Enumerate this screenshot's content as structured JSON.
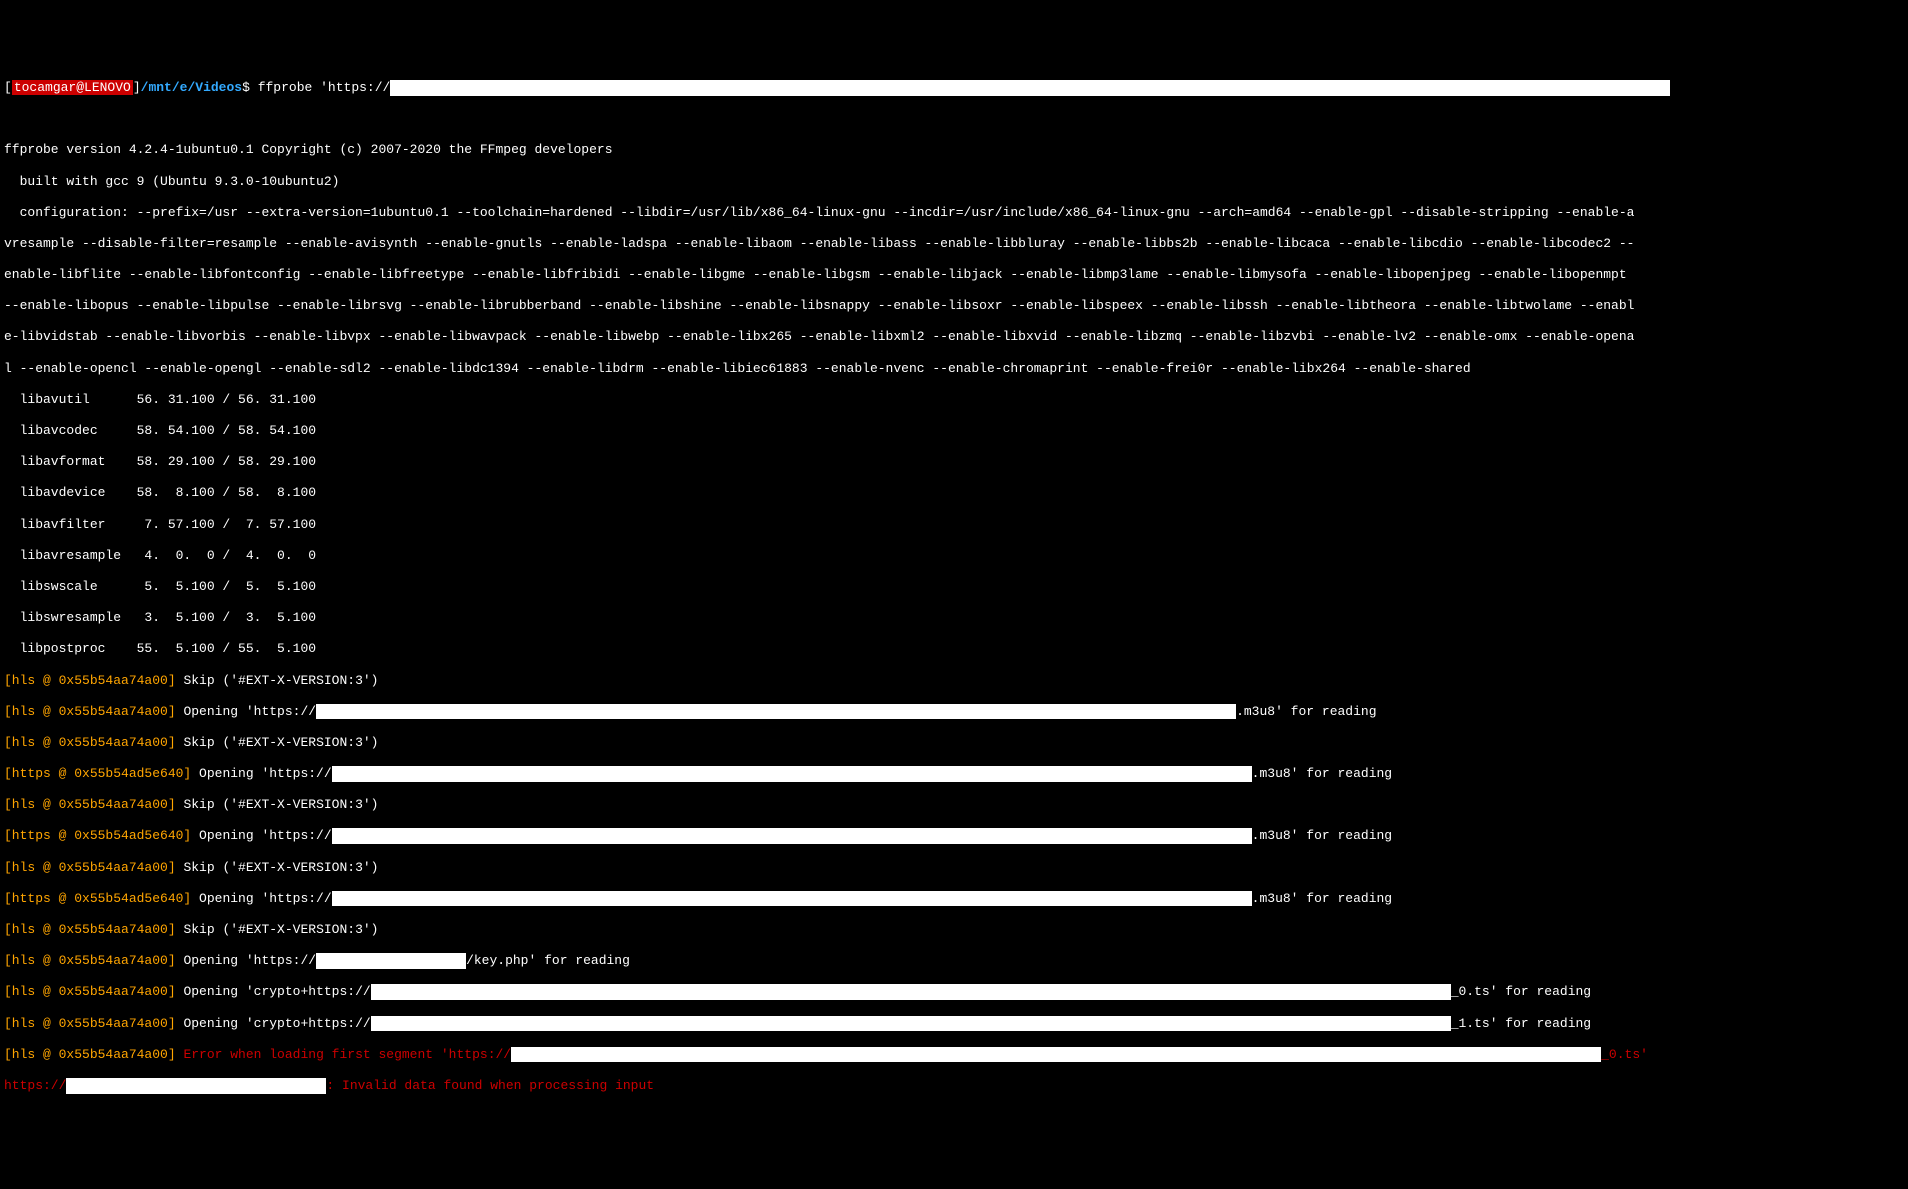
{
  "prompt": {
    "user": "tocamgar@LENOVO",
    "path": "/mnt/e/Videos",
    "dollar": "$",
    "command": "ffprobe 'https://"
  },
  "header": {
    "version_line": "ffprobe version 4.2.4-1ubuntu0.1 Copyright (c) 2007-2020 the FFmpeg developers",
    "built_line": "  built with gcc 9 (Ubuntu 9.3.0-10ubuntu2)",
    "config_line1": "  configuration: --prefix=/usr --extra-version=1ubuntu0.1 --toolchain=hardened --libdir=/usr/lib/x86_64-linux-gnu --incdir=/usr/include/x86_64-linux-gnu --arch=amd64 --enable-gpl --disable-stripping --enable-a",
    "config_line2": "vresample --disable-filter=resample --enable-avisynth --enable-gnutls --enable-ladspa --enable-libaom --enable-libass --enable-libbluray --enable-libbs2b --enable-libcaca --enable-libcdio --enable-libcodec2 --",
    "config_line3": "enable-libflite --enable-libfontconfig --enable-libfreetype --enable-libfribidi --enable-libgme --enable-libgsm --enable-libjack --enable-libmp3lame --enable-libmysofa --enable-libopenjpeg --enable-libopenmpt ",
    "config_line4": "--enable-libopus --enable-libpulse --enable-librsvg --enable-librubberband --enable-libshine --enable-libsnappy --enable-libsoxr --enable-libspeex --enable-libssh --enable-libtheora --enable-libtwolame --enabl",
    "config_line5": "e-libvidstab --enable-libvorbis --enable-libvpx --enable-libwavpack --enable-libwebp --enable-libx265 --enable-libxml2 --enable-libxvid --enable-libzmq --enable-libzvbi --enable-lv2 --enable-omx --enable-opena",
    "config_line6": "l --enable-opencl --enable-opengl --enable-sdl2 --enable-libdc1394 --enable-libdrm --enable-libiec61883 --enable-nvenc --enable-chromaprint --enable-frei0r --enable-libx264 --enable-shared"
  },
  "libs": {
    "avutil": "  libavutil      56. 31.100 / 56. 31.100",
    "avcodec": "  libavcodec     58. 54.100 / 58. 54.100",
    "avformat": "  libavformat    58. 29.100 / 58. 29.100",
    "avdevice": "  libavdevice    58.  8.100 / 58.  8.100",
    "avfilter": "  libavfilter     7. 57.100 /  7. 57.100",
    "avresample": "  libavresample   4.  0.  0 /  4.  0.  0",
    "swscale": "  libswscale      5.  5.100 /  5.  5.100",
    "swresample": "  libswresample   3.  5.100 /  3.  5.100",
    "postproc": "  libpostproc    55.  5.100 / 55.  5.100"
  },
  "log": {
    "hls_addr": "[hls @ 0x55b54aa74a00]",
    "https_addr": "[https @ 0x55b54ad5e640]",
    "skip_ext": " Skip ('#EXT-X-VERSION:3')",
    "opening_https": " Opening 'https://",
    "m3u8_reading": ".m3u8' for reading",
    "key_reading": "/key.php' for reading",
    "opening_crypto": " Opening 'crypto+https://",
    "ts0_reading": "_0.ts' for reading",
    "ts1_reading": "_1.ts' for reading",
    "error_segment": " Error when loading first segment 'https://",
    "error_ts_suffix": "_0.ts'",
    "https_prefix": "https://",
    "invalid_data": ": Invalid data found when processing input"
  }
}
